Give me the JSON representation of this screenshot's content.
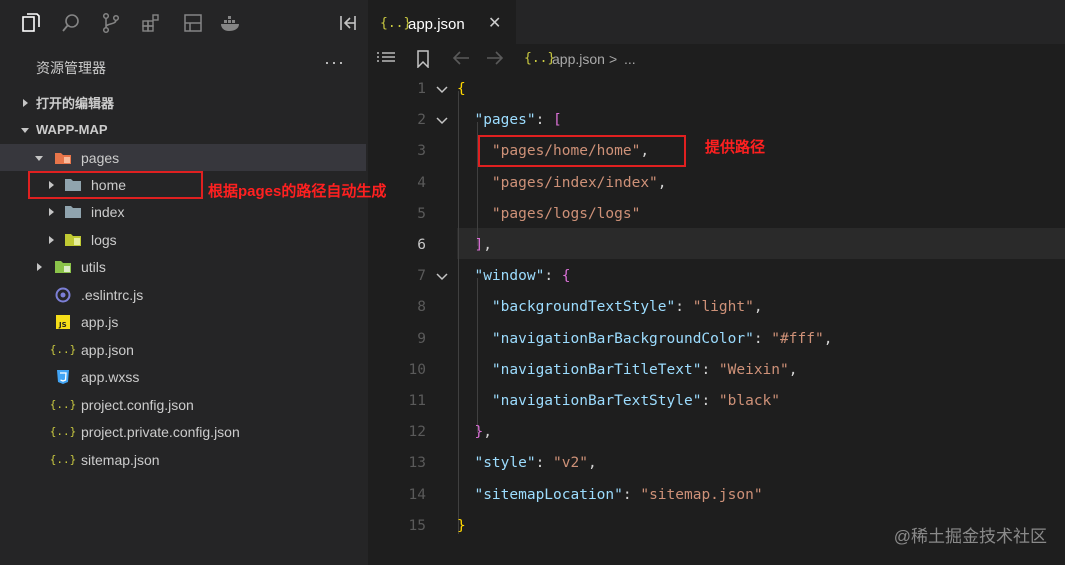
{
  "activity_bar": {
    "icons": [
      "explorer-icon",
      "search-icon",
      "source-control-icon",
      "extensions-icon",
      "layout-icon",
      "docker-icon",
      "collapse-panel-icon"
    ]
  },
  "sidebar": {
    "title": "资源管理器",
    "more": "···",
    "open_editors": "打开的编辑器",
    "project": "WAPP-MAP",
    "tree": {
      "pages": "pages",
      "home": "home",
      "index": "index",
      "logs": "logs",
      "utils": "utils",
      "eslintrc": ".eslintrc.js",
      "app_js": "app.js",
      "app_json": "app.json",
      "app_wxss": "app.wxss",
      "project_config": "project.config.json",
      "project_private": "project.private.config.json",
      "sitemap": "sitemap.json"
    },
    "file_icons": {
      "js": "JS",
      "json": "{..}",
      "eslint": "eslint-icon",
      "css": "css-icon"
    }
  },
  "tab": {
    "icon": "{..}",
    "label": "app.json",
    "close": "✕"
  },
  "breadcrumbs": {
    "icon": "{..}",
    "file": "app.json",
    "separator": ">",
    "rest": "..."
  },
  "editor": {
    "active_line": 6,
    "lines": [
      {
        "n": "1",
        "parts": [
          [
            "bl1",
            "{"
          ]
        ]
      },
      {
        "n": "2",
        "parts": [
          [
            "p",
            "  "
          ],
          [
            "k",
            "\"pages\""
          ],
          [
            "p",
            ": "
          ],
          [
            "bl2",
            "["
          ]
        ]
      },
      {
        "n": "3",
        "parts": [
          [
            "p",
            "    "
          ],
          [
            "s",
            "\"pages/home/home\""
          ],
          [
            "p",
            ","
          ]
        ]
      },
      {
        "n": "4",
        "parts": [
          [
            "p",
            "    "
          ],
          [
            "s",
            "\"pages/index/index\""
          ],
          [
            "p",
            ","
          ]
        ]
      },
      {
        "n": "5",
        "parts": [
          [
            "p",
            "    "
          ],
          [
            "s",
            "\"pages/logs/logs\""
          ]
        ]
      },
      {
        "n": "6",
        "parts": [
          [
            "p",
            "  "
          ],
          [
            "bl2",
            "]"
          ],
          [
            "p",
            ","
          ]
        ]
      },
      {
        "n": "7",
        "parts": [
          [
            "p",
            "  "
          ],
          [
            "k",
            "\"window\""
          ],
          [
            "p",
            ": "
          ],
          [
            "bl2",
            "{"
          ]
        ]
      },
      {
        "n": "8",
        "parts": [
          [
            "p",
            "    "
          ],
          [
            "k",
            "\"backgroundTextStyle\""
          ],
          [
            "p",
            ": "
          ],
          [
            "s",
            "\"light\""
          ],
          [
            "p",
            ","
          ]
        ]
      },
      {
        "n": "9",
        "parts": [
          [
            "p",
            "    "
          ],
          [
            "k",
            "\"navigationBarBackgroundColor\""
          ],
          [
            "p",
            ": "
          ],
          [
            "s",
            "\"#fff\""
          ],
          [
            "p",
            ","
          ]
        ]
      },
      {
        "n": "10",
        "parts": [
          [
            "p",
            "    "
          ],
          [
            "k",
            "\"navigationBarTitleText\""
          ],
          [
            "p",
            ": "
          ],
          [
            "s",
            "\"Weixin\""
          ],
          [
            "p",
            ","
          ]
        ]
      },
      {
        "n": "11",
        "parts": [
          [
            "p",
            "    "
          ],
          [
            "k",
            "\"navigationBarTextStyle\""
          ],
          [
            "p",
            ": "
          ],
          [
            "s",
            "\"black\""
          ]
        ]
      },
      {
        "n": "12",
        "parts": [
          [
            "p",
            "  "
          ],
          [
            "bl2",
            "}"
          ],
          [
            "p",
            ","
          ]
        ]
      },
      {
        "n": "13",
        "parts": [
          [
            "p",
            "  "
          ],
          [
            "k",
            "\"style\""
          ],
          [
            "p",
            ": "
          ],
          [
            "s",
            "\"v2\""
          ],
          [
            "p",
            ","
          ]
        ]
      },
      {
        "n": "14",
        "parts": [
          [
            "p",
            "  "
          ],
          [
            "k",
            "\"sitemapLocation\""
          ],
          [
            "p",
            ": "
          ],
          [
            "s",
            "\"sitemap.json\""
          ]
        ]
      },
      {
        "n": "15",
        "parts": [
          [
            "bl1",
            "}"
          ]
        ]
      }
    ]
  },
  "annotations": {
    "left": "根据pages的路径自动生成",
    "right": "提供路径"
  },
  "watermark": "@稀土掘金技术社区",
  "colors": {
    "annotation": "#e02020",
    "string": "#ce9178",
    "key": "#9cdcfe",
    "bracket_outer": "#ffd700",
    "bracket_inner": "#da70d6"
  }
}
